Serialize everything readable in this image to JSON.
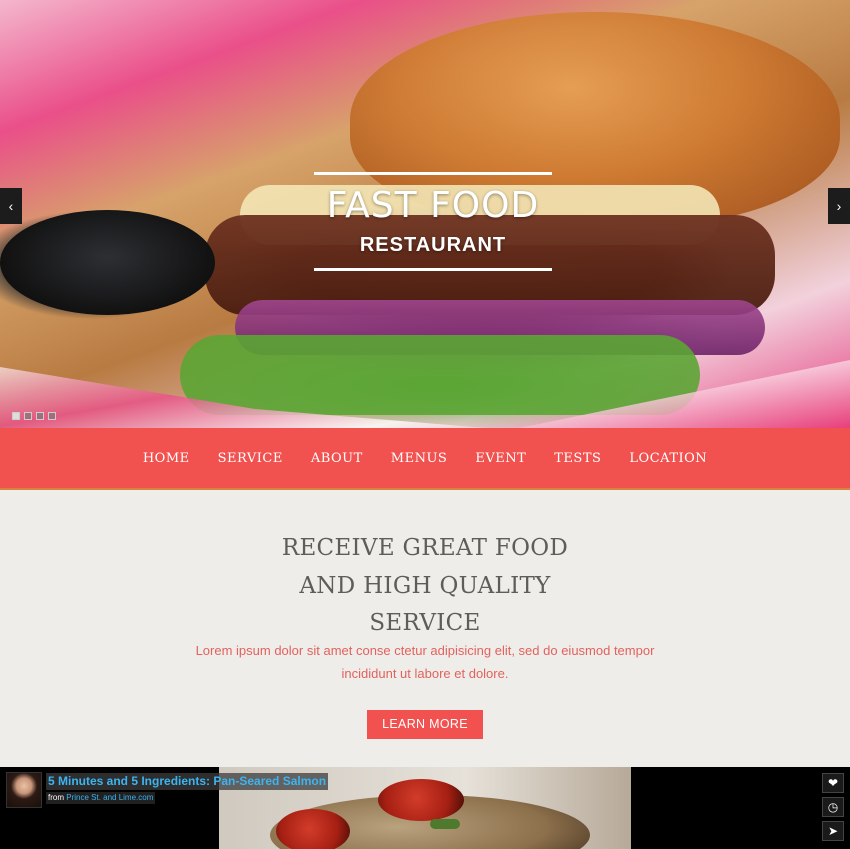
{
  "hero": {
    "title": "FAST FOOD",
    "subtitle": "RESTAURANT",
    "prev_arrow": "‹",
    "next_arrow": "›",
    "slide_count": 4,
    "active_slide": 1
  },
  "nav": {
    "items": [
      "HOME",
      "SERVICE",
      "ABOUT",
      "MENUS",
      "EVENT",
      "TESTS",
      "LOCATION"
    ]
  },
  "content": {
    "headline_line1": "RECEIVE GREAT FOOD",
    "headline_line2": "AND HIGH QUALITY",
    "headline_line3": "SERVICE",
    "lorem_line1": "Lorem ipsum dolor sit amet conse ctetur adipisicing elit, sed do eiusmod tempor",
    "lorem_line2": "incididunt ut labore et dolore.",
    "button_label": "LEARN MORE"
  },
  "video": {
    "title": "5 Minutes and 5 Ingredients: Pan-Seared Salmon",
    "source_prefix": "from",
    "source_name": "Prince St. and Lime.com",
    "icons": [
      "heart-icon",
      "clock-icon",
      "send-icon"
    ]
  },
  "colors": {
    "accent": "#f2524f",
    "headline": "#5f5d57",
    "lorem": "#e2625d",
    "link": "#3db4f2"
  }
}
